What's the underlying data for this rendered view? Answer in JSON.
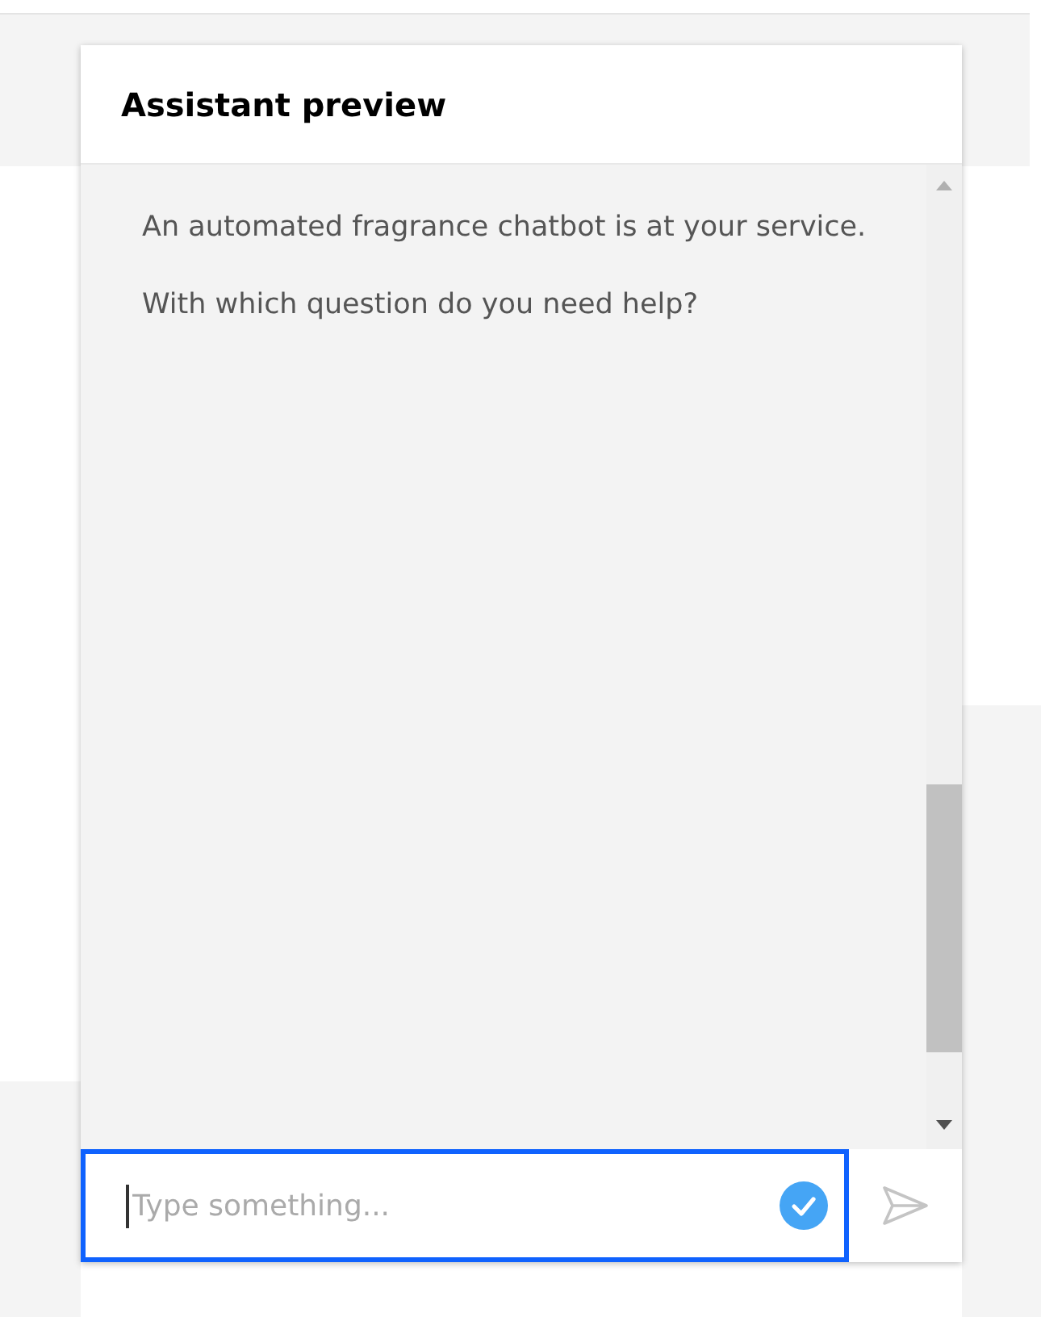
{
  "panel": {
    "title": "Assistant preview"
  },
  "messages": [
    {
      "text": "An automated fragrance chatbot is at your service."
    },
    {
      "text": "With which question do you need help?"
    }
  ],
  "input": {
    "placeholder": "Type something...",
    "focused": true
  }
}
